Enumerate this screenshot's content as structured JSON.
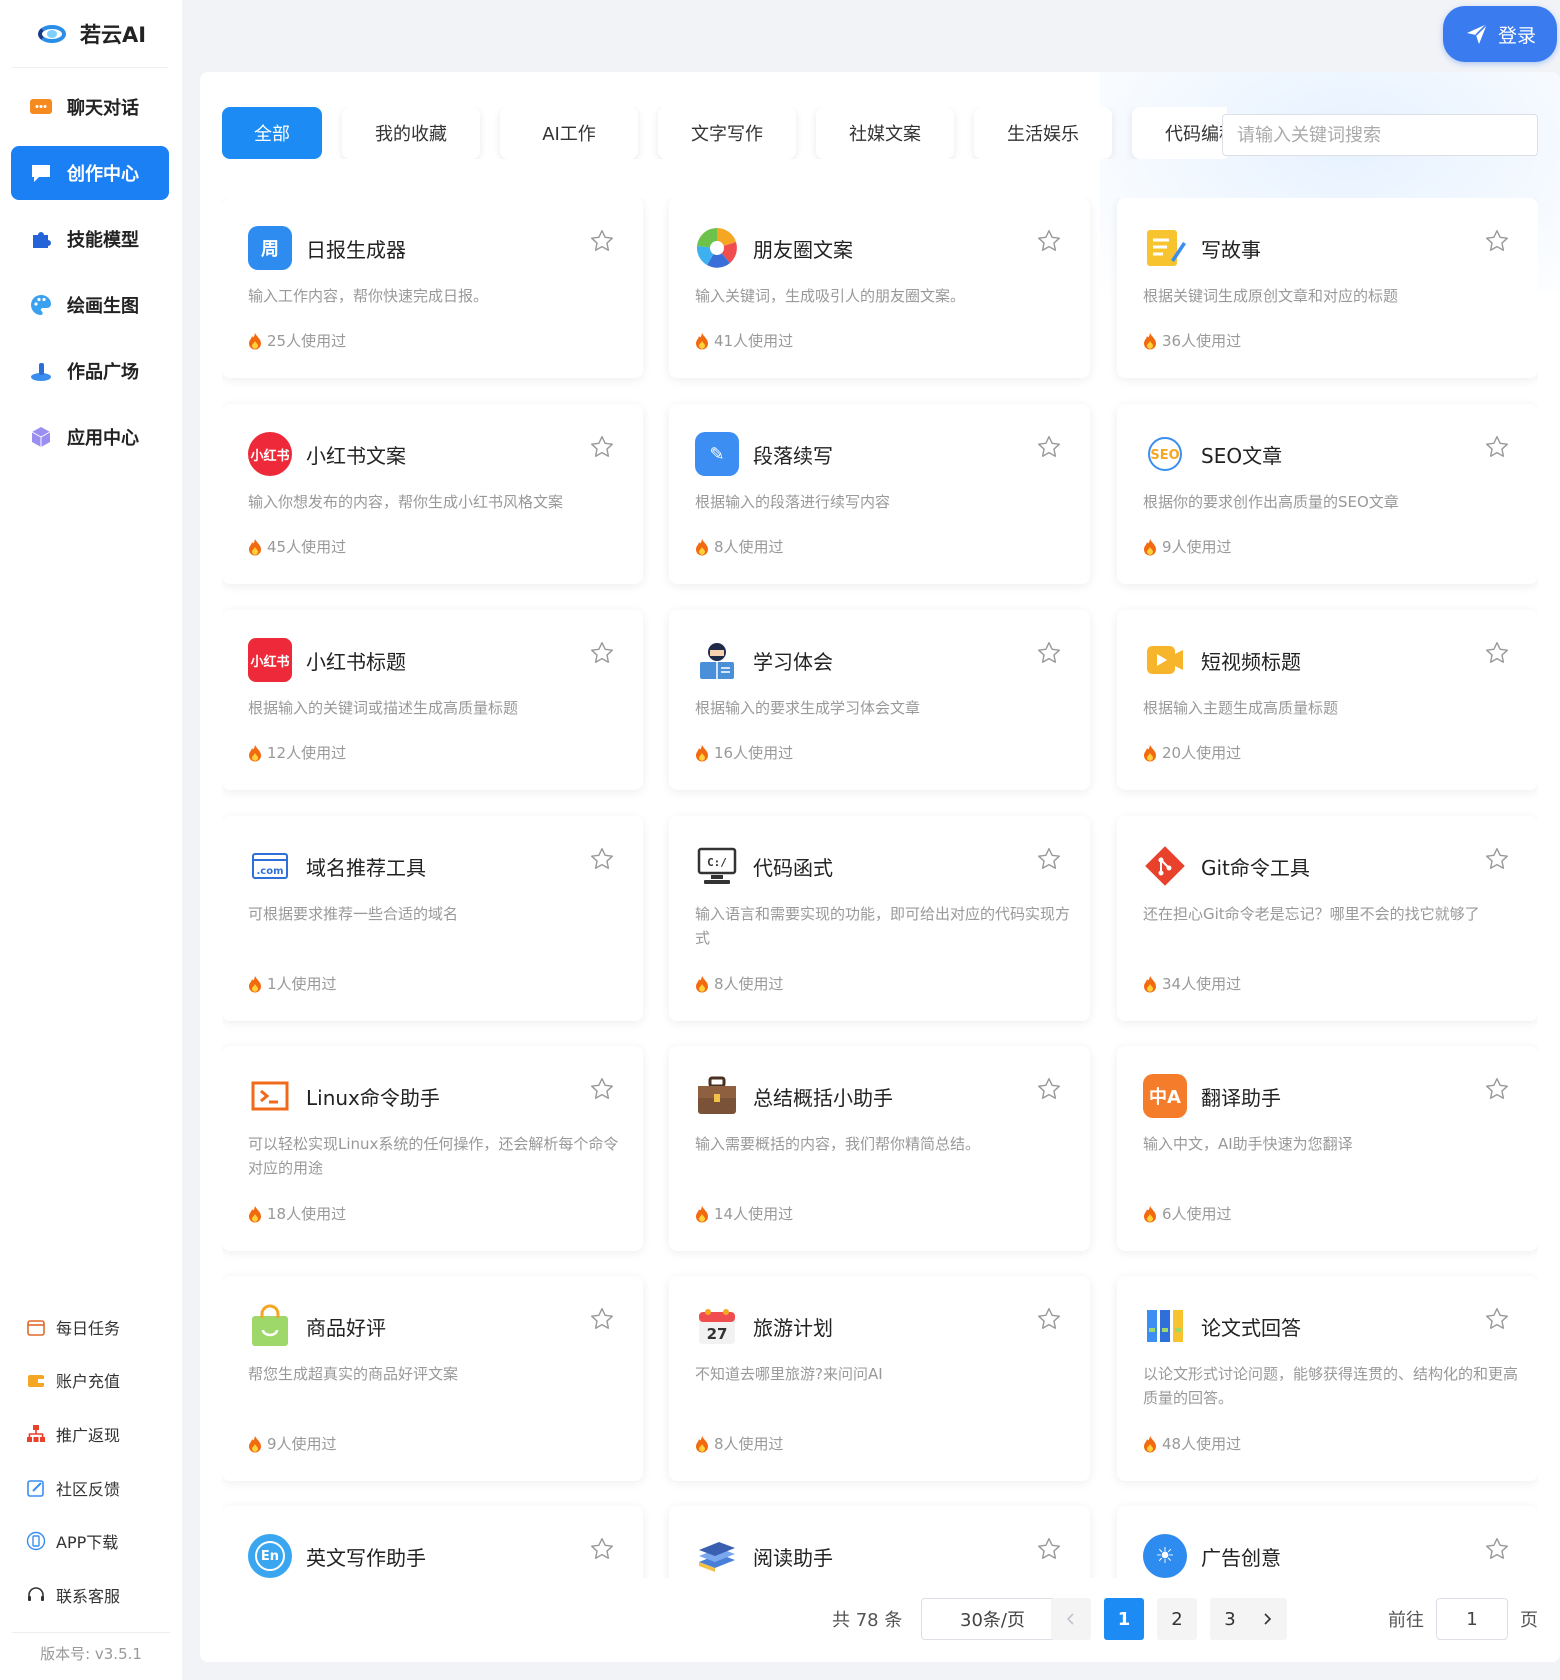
{
  "brand": {
    "name": "若云AI"
  },
  "login": {
    "label": "登录"
  },
  "nav": [
    {
      "label": "聊天对话",
      "icon": "chat-icon",
      "active": false
    },
    {
      "label": "创作中心",
      "icon": "creation-icon",
      "active": true
    },
    {
      "label": "技能模型",
      "icon": "puzzle-icon",
      "active": false
    },
    {
      "label": "绘画生图",
      "icon": "palette-icon",
      "active": false
    },
    {
      "label": "作品广场",
      "icon": "plaza-icon",
      "active": false
    },
    {
      "label": "应用中心",
      "icon": "cube-icon",
      "active": false
    }
  ],
  "bottom_nav": [
    {
      "label": "每日任务",
      "icon": "calendar-icon"
    },
    {
      "label": "账户充值",
      "icon": "wallet-icon"
    },
    {
      "label": "推广返现",
      "icon": "share-icon"
    },
    {
      "label": "社区反馈",
      "icon": "edit-icon"
    },
    {
      "label": "APP下载",
      "icon": "phone-icon"
    },
    {
      "label": "联系客服",
      "icon": "headset-icon"
    }
  ],
  "version": "版本号: v3.5.1",
  "tabs": [
    "全部",
    "我的收藏",
    "AI工作",
    "文字写作",
    "社媒文案",
    "生活娱乐",
    "代码编程"
  ],
  "search": {
    "placeholder": "请输入关键词搜索"
  },
  "cards": [
    {
      "title": "日报生成器",
      "desc": "输入工作内容，帮你快速完成日报。",
      "uses": "25人使用过",
      "icon": "daily-report-icon",
      "color": "#2e8cf0",
      "glyph": "周"
    },
    {
      "title": "朋友圈文案",
      "desc": "输入关键词，生成吸引人的朋友圈文案。",
      "uses": "41人使用过",
      "icon": "aperture-icon",
      "color": "#f5a623",
      "glyph": ""
    },
    {
      "title": "写故事",
      "desc": "根据关键词生成原创文章和对应的标题",
      "uses": "36人使用过",
      "icon": "notepad-icon",
      "color": "#f7c42f",
      "glyph": "≡"
    },
    {
      "title": "小红书文案",
      "desc": "输入你想发布的内容，帮你生成小红书风格文案",
      "uses": "45人使用过",
      "icon": "xiaohongshu-icon",
      "color": "#ee2a3a",
      "glyph": "小红书"
    },
    {
      "title": "段落续写",
      "desc": "根据输入的段落进行续写内容",
      "uses": "8人使用过",
      "icon": "pen-document-icon",
      "color": "#3d8ef2",
      "glyph": "✎"
    },
    {
      "title": "SEO文章",
      "desc": "根据你的要求创作出高质量的SEO文章",
      "uses": "9人使用过",
      "icon": "seo-icon",
      "color": "#ffffff",
      "glyph": "SEO"
    },
    {
      "title": "小红书标题",
      "desc": "根据输入的关键词或描述生成高质量标题",
      "uses": "12人使用过",
      "icon": "xiaohongshu-icon",
      "color": "#ee2a3a",
      "glyph": "小红书"
    },
    {
      "title": "学习体会",
      "desc": "根据输入的要求生成学习体会文章",
      "uses": "16人使用过",
      "icon": "student-reading-icon",
      "color": "#4a90d9",
      "glyph": "📖"
    },
    {
      "title": "短视频标题",
      "desc": "根据输入主题生成高质量标题",
      "uses": "20人使用过",
      "icon": "video-icon",
      "color": "#f7b52c",
      "glyph": "▶"
    },
    {
      "title": "域名推荐工具",
      "desc": "可根据要求推荐一些合适的域名",
      "uses": "1人使用过",
      "icon": "domain-icon",
      "color": "#ffffff",
      "glyph": ".com"
    },
    {
      "title": "代码函式",
      "desc": "输入语言和需要实现的功能，即可给出对应的代码实现方式",
      "uses": "8人使用过",
      "icon": "code-computer-icon",
      "color": "#ffffff",
      "glyph": "C:/"
    },
    {
      "title": "Git命令工具",
      "desc": "还在担心Git命令老是忘记？哪里不会的找它就够了",
      "uses": "34人使用过",
      "icon": "git-icon",
      "color": "#e8412c",
      "glyph": "◆"
    },
    {
      "title": "Linux命令助手",
      "desc": "可以轻松实现Linux系统的任何操作，还会解析每个命令对应的用途",
      "uses": "18人使用过",
      "icon": "terminal-icon",
      "color": "#ffffff",
      "glyph": ">_"
    },
    {
      "title": "总结概括小助手",
      "desc": "输入需要概括的内容，我们帮你精简总结。",
      "uses": "14人使用过",
      "icon": "briefcase-icon",
      "color": "#7a5238",
      "glyph": "▮"
    },
    {
      "title": "翻译助手",
      "desc": "输入中文，AI助手快速为您翻译",
      "uses": "6人使用过",
      "icon": "translate-icon",
      "color": "#f57c2b",
      "glyph": "中A"
    },
    {
      "title": "商品好评",
      "desc": "帮您生成超真实的商品好评文案",
      "uses": "9人使用过",
      "icon": "shopping-bag-icon",
      "color": "#9ed86a",
      "glyph": "☺"
    },
    {
      "title": "旅游计划",
      "desc": "不知道去哪里旅游?来问问AI",
      "uses": "8人使用过",
      "icon": "calendar-27-icon",
      "color": "#ffffff",
      "glyph": "27"
    },
    {
      "title": "论文式回答",
      "desc": "以论文形式讨论问题，能够获得连贯的、结构化的和更高质量的回答。",
      "uses": "48人使用过",
      "icon": "binders-icon",
      "color": "#3d8ef2",
      "glyph": "|||"
    },
    {
      "title": "英文写作助手",
      "desc": "",
      "uses": "",
      "icon": "english-icon",
      "color": "#3aa6f0",
      "glyph": "En"
    },
    {
      "title": "阅读助手",
      "desc": "",
      "uses": "",
      "icon": "books-icon",
      "color": "#4a7fd9",
      "glyph": "📚"
    },
    {
      "title": "广告创意",
      "desc": "",
      "uses": "",
      "icon": "lightbulb-icon",
      "color": "#2e8cf0",
      "glyph": "☀"
    }
  ],
  "pagination": {
    "total": "共 78 条",
    "page_size": "30条/页",
    "pages": [
      "1",
      "2",
      "3"
    ],
    "current": "1",
    "goto_label": "前往",
    "goto_value": "1",
    "page_suffix": "页"
  }
}
